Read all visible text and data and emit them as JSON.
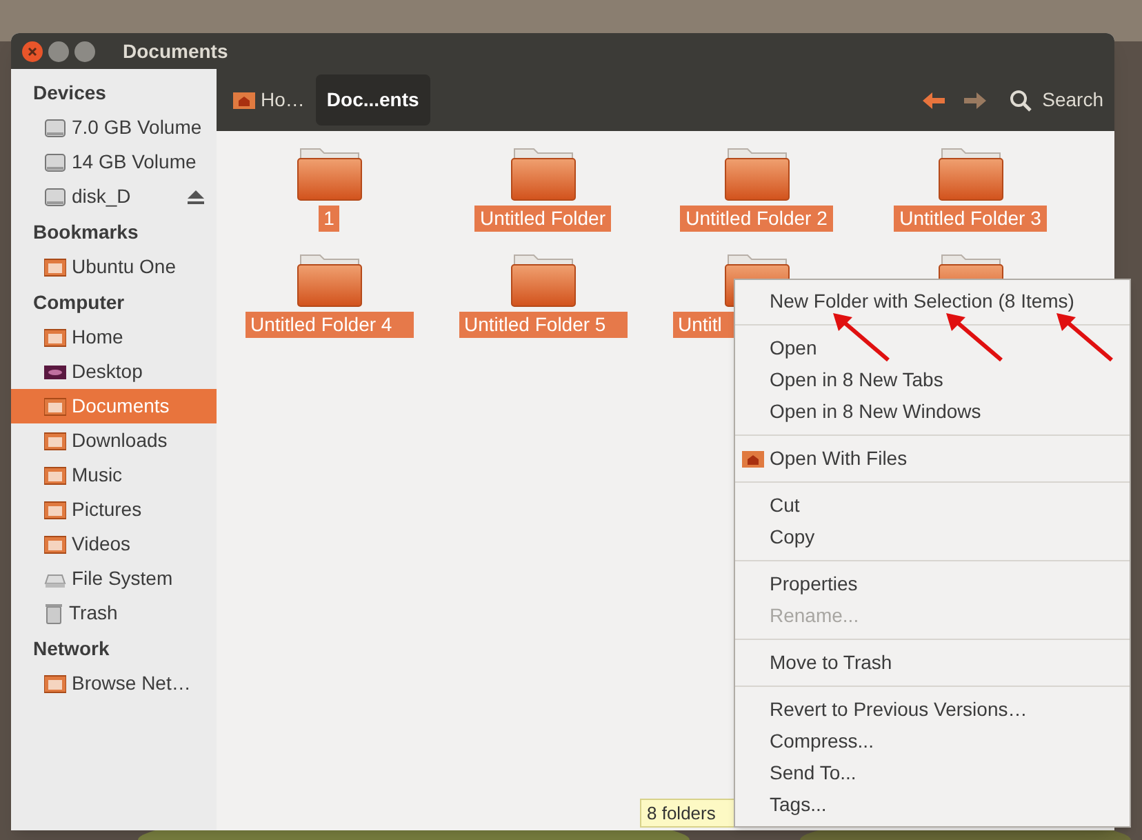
{
  "window": {
    "title": "Documents"
  },
  "sidebar": {
    "sections": [
      {
        "title": "Devices",
        "items": [
          {
            "label": "7.0 GB Volume",
            "selected": false
          },
          {
            "label": "14 GB Volume",
            "selected": false
          },
          {
            "label": "disk_D",
            "selected": false,
            "eject": true
          }
        ]
      },
      {
        "title": "Bookmarks",
        "items": [
          {
            "label": "Ubuntu One",
            "selected": false
          }
        ]
      },
      {
        "title": "Computer",
        "items": [
          {
            "label": "Home",
            "selected": false
          },
          {
            "label": "Desktop",
            "selected": false
          },
          {
            "label": "Documents",
            "selected": true
          },
          {
            "label": "Downloads",
            "selected": false
          },
          {
            "label": "Music",
            "selected": false
          },
          {
            "label": "Pictures",
            "selected": false
          },
          {
            "label": "Videos",
            "selected": false
          },
          {
            "label": "File System",
            "selected": false
          },
          {
            "label": "Trash",
            "selected": false
          }
        ]
      },
      {
        "title": "Network",
        "items": [
          {
            "label": "Browse Net…",
            "selected": false
          }
        ]
      }
    ]
  },
  "breadcrumbs": [
    {
      "label": "Ho…",
      "selected": false
    },
    {
      "label": "Doc...ents",
      "selected": true
    }
  ],
  "toolbar": {
    "search": "Search"
  },
  "folders": [
    {
      "kind": "folder",
      "label": "1",
      "selected": true
    },
    {
      "kind": "folder",
      "label": "Untitled Folder",
      "selected": true
    },
    {
      "kind": "folder",
      "label": "Untitled Folder 2",
      "selected": true
    },
    {
      "kind": "folder",
      "label": "Untitled Folder 3",
      "selected": true
    },
    {
      "kind": "folder",
      "label": "Untitled Folder 4",
      "selected": true
    },
    {
      "kind": "folder",
      "label": "Untitled Folder 5",
      "selected": true
    },
    {
      "kind": "folder",
      "label": "Untitl",
      "selected": true
    },
    {
      "kind": "folder"
    }
  ],
  "context_menu": [
    {
      "kind": "item",
      "label": "New Folder with Selection (8 Items)",
      "disabled": false
    },
    {
      "kind": "separator"
    },
    {
      "kind": "item",
      "label": "Open",
      "disabled": false
    },
    {
      "kind": "item",
      "label": "Open in 8 New Tabs",
      "disabled": false
    },
    {
      "kind": "item",
      "label": "Open in 8 New Windows",
      "disabled": false
    },
    {
      "kind": "separator"
    },
    {
      "kind": "icon-item",
      "label": "Open With Files",
      "disabled": false
    },
    {
      "kind": "separator"
    },
    {
      "kind": "item",
      "label": "Cut",
      "disabled": false
    },
    {
      "kind": "item",
      "label": "Copy",
      "disabled": false
    },
    {
      "kind": "separator"
    },
    {
      "kind": "item",
      "label": "Properties",
      "disabled": false
    },
    {
      "kind": "item",
      "label": "Rename...",
      "disabled": true
    },
    {
      "kind": "separator"
    },
    {
      "kind": "item",
      "label": "Move to Trash",
      "disabled": false
    },
    {
      "kind": "separator"
    },
    {
      "kind": "item",
      "label": "Revert to Previous Versions…",
      "disabled": false
    },
    {
      "kind": "item",
      "label": "Compress...",
      "disabled": false
    },
    {
      "kind": "item",
      "label": "Send To...",
      "disabled": false
    },
    {
      "kind": "item",
      "label": "Tags...",
      "disabled": false
    }
  ],
  "status_bar": "8 folders"
}
